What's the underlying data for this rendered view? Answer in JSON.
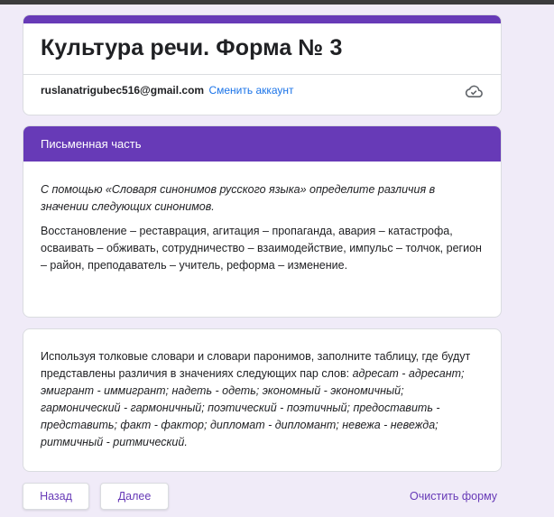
{
  "form": {
    "title": "Культура речи. Форма № 3",
    "account_email": "ruslanatrigubec516@gmail.com",
    "switch_account": "Сменить аккаунт",
    "save_status_icon": "cloud-check-icon"
  },
  "section": {
    "header": "Письменная часть",
    "instruction": "С помощью «Словаря синонимов русского языка» определите различия в значении следующих синонимов.",
    "synonyms": "Восстановление – реставрация, агитация – пропаганда, авария – катастрофа, осваивать – обживать, сотрудничество – взаимодействие, импульс – толчок, регион – район, преподаватель – учитель, реформа – изменение."
  },
  "task": {
    "intro": "Используя толковые словари и словари паронимов, заполните таблицу, где будут представлены различия в значениях следующих пар слов: ",
    "pairs": "адресат - адресант; эмигрант - иммигрант; надеть - одеть; экономный - экономичный; гармонический - гармоничный;  поэтический - поэтичный; предоставить - представить; факт - фактор; дипломат - дипломант; невежа - невежда; ритмичный - ритмический."
  },
  "nav": {
    "back": "Назад",
    "next": "Далее",
    "clear": "Очистить форму"
  },
  "colors": {
    "accent": "#673ab7",
    "background": "#f0ebf8",
    "link": "#1a73e8"
  }
}
